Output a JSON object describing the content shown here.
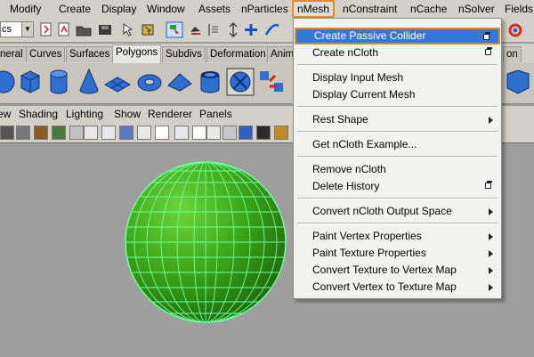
{
  "menubar": {
    "items": [
      "Modify",
      "Create",
      "Display",
      "Window",
      "Assets",
      "nParticles",
      "nMesh",
      "nConstraint",
      "nCache",
      "nSolver",
      "Fields"
    ],
    "active": "nMesh",
    "tail": "F"
  },
  "statusline": {
    "mode_value": "cs"
  },
  "shelf": {
    "tabs": [
      "neral",
      "Curves",
      "Surfaces",
      "Polygons",
      "Subdivs",
      "Deformation",
      "Anim"
    ],
    "selected": "Polygons",
    "right_tab": "on"
  },
  "panel": {
    "menus": [
      "ew",
      "Shading",
      "Lighting",
      "Show",
      "Renderer",
      "Panels"
    ]
  },
  "nmesh_menu": {
    "items": [
      {
        "label": "Create Passive Collider",
        "option": true,
        "highlight": true
      },
      {
        "label": "Create nCloth",
        "option": true
      },
      {
        "sep": true
      },
      {
        "label": "Display Input Mesh"
      },
      {
        "label": "Display Current Mesh"
      },
      {
        "sep": true
      },
      {
        "label": "Rest Shape",
        "submenu": true
      },
      {
        "sep": true
      },
      {
        "label": "Get nCloth Example..."
      },
      {
        "sep": true
      },
      {
        "label": "Remove nCloth"
      },
      {
        "label": "Delete History",
        "option": true
      },
      {
        "sep": true
      },
      {
        "label": "Convert nCloth Output Space",
        "submenu": true
      },
      {
        "sep": true
      },
      {
        "label": "Paint Vertex Properties",
        "submenu": true
      },
      {
        "label": "Paint Texture Properties",
        "submenu": true
      },
      {
        "label": "Convert Texture to Vertex Map",
        "submenu": true
      },
      {
        "label": "Convert Vertex to Texture Map",
        "submenu": true
      }
    ]
  },
  "colors": {
    "accent": "#e08a2c",
    "highlight": "#3478d8",
    "sphere": "#3fb01c",
    "wire": "#6dff9a"
  }
}
